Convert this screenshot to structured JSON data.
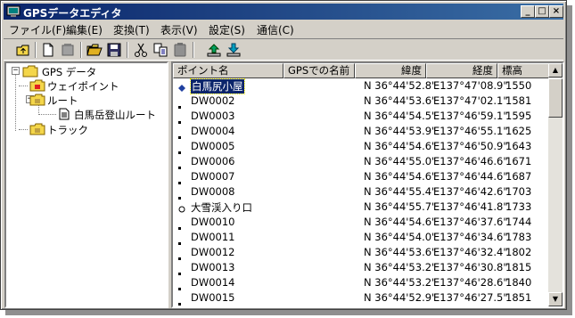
{
  "window": {
    "title": "GPSデータエディタ"
  },
  "title_buttons": {
    "minimize": "_",
    "maximize": "□",
    "close": "×"
  },
  "menu": [
    "ファイル(F)",
    "編集(E)",
    "変換(T)",
    "表示(V)",
    "設定(S)",
    "通信(C)"
  ],
  "toolbar": [
    "up-folder",
    "new-file",
    "delete",
    "open-folder",
    "save",
    "cut",
    "copy",
    "paste",
    "upload",
    "download"
  ],
  "tree": {
    "root": "GPS データ",
    "waypoints": "ウェイポイント",
    "route": "ルート",
    "route_item": "白馬岳登山ルート",
    "track": "トラック",
    "expanders": {
      "root": "−",
      "route": "−"
    }
  },
  "columns": {
    "point_name": "ポイント名",
    "gps_name": "GPSでの名前",
    "lat": "緯度",
    "lon": "経度",
    "alt": "標高"
  },
  "points": [
    {
      "name": "白馬尻小屋",
      "lat": "N 36°44'52.8\"",
      "lon": "E137°47'08.9\"",
      "alt": "1550",
      "marker": "diamond",
      "selected": true
    },
    {
      "name": "DW0002",
      "lat": "N 36°44'53.6\"",
      "lon": "E137°47'02.1\"",
      "alt": "1581",
      "marker": "dot"
    },
    {
      "name": "DW0003",
      "lat": "N 36°44'54.5\"",
      "lon": "E137°46'59.1\"",
      "alt": "1595",
      "marker": "dot"
    },
    {
      "name": "DW0004",
      "lat": "N 36°44'53.9\"",
      "lon": "E137°46'55.1\"",
      "alt": "1625",
      "marker": "dot"
    },
    {
      "name": "DW0005",
      "lat": "N 36°44'54.6\"",
      "lon": "E137°46'50.9\"",
      "alt": "1643",
      "marker": "dot"
    },
    {
      "name": "DW0006",
      "lat": "N 36°44'55.0\"",
      "lon": "E137°46'46.6\"",
      "alt": "1671",
      "marker": "dot"
    },
    {
      "name": "DW0007",
      "lat": "N 36°44'54.6\"",
      "lon": "E137°46'44.6\"",
      "alt": "1687",
      "marker": "dot"
    },
    {
      "name": "DW0008",
      "lat": "N 36°44'55.4\"",
      "lon": "E137°46'42.6\"",
      "alt": "1703",
      "marker": "dot"
    },
    {
      "name": "大雪渓入り口",
      "lat": "N 36°44'55.7\"",
      "lon": "E137°46'41.8\"",
      "alt": "1733",
      "marker": "circle"
    },
    {
      "name": "DW0010",
      "lat": "N 36°44'54.6\"",
      "lon": "E137°46'37.6\"",
      "alt": "1744",
      "marker": "dot"
    },
    {
      "name": "DW0011",
      "lat": "N 36°44'54.0\"",
      "lon": "E137°46'34.6\"",
      "alt": "1783",
      "marker": "dot"
    },
    {
      "name": "DW0012",
      "lat": "N 36°44'53.6\"",
      "lon": "E137°46'32.4\"",
      "alt": "1802",
      "marker": "dot"
    },
    {
      "name": "DW0013",
      "lat": "N 36°44'53.2\"",
      "lon": "E137°46'30.8\"",
      "alt": "1815",
      "marker": "dot"
    },
    {
      "name": "DW0014",
      "lat": "N 36°44'53.2\"",
      "lon": "E137°46'28.6\"",
      "alt": "1840",
      "marker": "dot"
    },
    {
      "name": "DW0015",
      "lat": "N 36°44'52.9\"",
      "lon": "E137°46'27.5\"",
      "alt": "1851",
      "marker": "dot"
    }
  ],
  "scrollbar": {
    "up": "▲",
    "down": "▼"
  },
  "colors": {
    "title_start": "#0a246a",
    "title_end": "#3a6ea5",
    "selection": "#0a246a",
    "face": "#d4d0c8",
    "folder": "#f4d64a"
  }
}
